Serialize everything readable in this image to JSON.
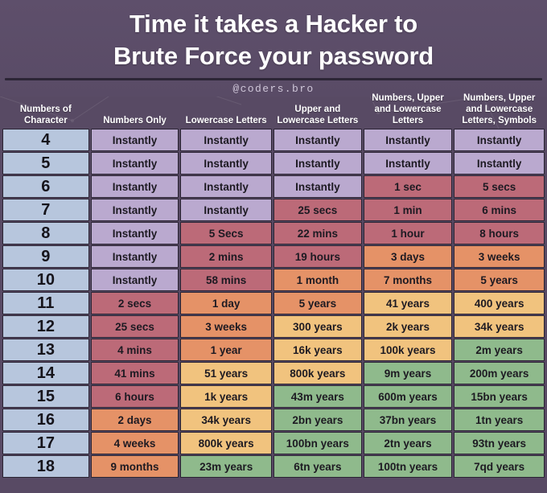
{
  "header": {
    "title_line_1": "Time it takes a Hacker to",
    "title_line_2": "Brute Force your password",
    "handle": "@coders.bro"
  },
  "colors": {
    "background": "#584a64",
    "rule": "#2c2536",
    "cell_border": "#2a2433",
    "blue": "#b7c6dd",
    "purple": "#baa9cf",
    "red": "#bc6a78",
    "orange": "#e59267",
    "yellow": "#f1c37e",
    "green": "#8fba8c"
  },
  "chart_data": {
    "type": "heatmap",
    "title": "Time it takes a Hacker to Brute Force your password",
    "subtitle": "@coders.bro",
    "xlabel": "",
    "ylabel": "Numbers of Character",
    "grid": true,
    "legend": "none",
    "columns": [
      "Numbers of Character",
      "Numbers Only",
      "Lowercase Letters",
      "Upper and Lowercase Letters",
      "Numbers, Upper and Lowercase Letters",
      "Numbers, Upper and Lowercase Letters, Symbols"
    ],
    "categories": [
      "4",
      "5",
      "6",
      "7",
      "8",
      "9",
      "10",
      "11",
      "12",
      "13",
      "14",
      "15",
      "16",
      "17",
      "18"
    ],
    "color_scale": [
      "purple",
      "red",
      "orange",
      "yellow",
      "green"
    ],
    "color_scale_meaning": "purple = instant, red = seconds to hours, orange = days to years, yellow = thousands of years, green = millions of years and beyond",
    "rows": [
      {
        "chars": "4",
        "cells": [
          {
            "text": "Instantly",
            "color": "purple"
          },
          {
            "text": "Instantly",
            "color": "purple"
          },
          {
            "text": "Instantly",
            "color": "purple"
          },
          {
            "text": "Instantly",
            "color": "purple"
          },
          {
            "text": "Instantly",
            "color": "purple"
          }
        ]
      },
      {
        "chars": "5",
        "cells": [
          {
            "text": "Instantly",
            "color": "purple"
          },
          {
            "text": "Instantly",
            "color": "purple"
          },
          {
            "text": "Instantly",
            "color": "purple"
          },
          {
            "text": "Instantly",
            "color": "purple"
          },
          {
            "text": "Instantly",
            "color": "purple"
          }
        ]
      },
      {
        "chars": "6",
        "cells": [
          {
            "text": "Instantly",
            "color": "purple"
          },
          {
            "text": "Instantly",
            "color": "purple"
          },
          {
            "text": "Instantly",
            "color": "purple"
          },
          {
            "text": "1 sec",
            "color": "red"
          },
          {
            "text": "5 secs",
            "color": "red"
          }
        ]
      },
      {
        "chars": "7",
        "cells": [
          {
            "text": "Instantly",
            "color": "purple"
          },
          {
            "text": "Instantly",
            "color": "purple"
          },
          {
            "text": "25 secs",
            "color": "red"
          },
          {
            "text": "1 min",
            "color": "red"
          },
          {
            "text": "6 mins",
            "color": "red"
          }
        ]
      },
      {
        "chars": "8",
        "cells": [
          {
            "text": "Instantly",
            "color": "purple"
          },
          {
            "text": "5 Secs",
            "color": "red"
          },
          {
            "text": "22 mins",
            "color": "red"
          },
          {
            "text": "1 hour",
            "color": "red"
          },
          {
            "text": "8 hours",
            "color": "red"
          }
        ]
      },
      {
        "chars": "9",
        "cells": [
          {
            "text": "Instantly",
            "color": "purple"
          },
          {
            "text": "2 mins",
            "color": "red"
          },
          {
            "text": "19 hours",
            "color": "red"
          },
          {
            "text": "3 days",
            "color": "orange"
          },
          {
            "text": "3 weeks",
            "color": "orange"
          }
        ]
      },
      {
        "chars": "10",
        "cells": [
          {
            "text": "Instantly",
            "color": "purple"
          },
          {
            "text": "58 mins",
            "color": "red"
          },
          {
            "text": "1 month",
            "color": "orange"
          },
          {
            "text": "7 months",
            "color": "orange"
          },
          {
            "text": "5 years",
            "color": "orange"
          }
        ]
      },
      {
        "chars": "11",
        "cells": [
          {
            "text": "2 secs",
            "color": "red"
          },
          {
            "text": "1 day",
            "color": "orange"
          },
          {
            "text": "5 years",
            "color": "orange"
          },
          {
            "text": "41 years",
            "color": "yellow"
          },
          {
            "text": "400 years",
            "color": "yellow"
          }
        ]
      },
      {
        "chars": "12",
        "cells": [
          {
            "text": "25 secs",
            "color": "red"
          },
          {
            "text": "3 weeks",
            "color": "orange"
          },
          {
            "text": "300 years",
            "color": "yellow"
          },
          {
            "text": "2k years",
            "color": "yellow"
          },
          {
            "text": "34k years",
            "color": "yellow"
          }
        ]
      },
      {
        "chars": "13",
        "cells": [
          {
            "text": "4 mins",
            "color": "red"
          },
          {
            "text": "1 year",
            "color": "orange"
          },
          {
            "text": "16k years",
            "color": "yellow"
          },
          {
            "text": "100k years",
            "color": "yellow"
          },
          {
            "text": "2m years",
            "color": "green"
          }
        ]
      },
      {
        "chars": "14",
        "cells": [
          {
            "text": "41 mins",
            "color": "red"
          },
          {
            "text": "51 years",
            "color": "yellow"
          },
          {
            "text": "800k years",
            "color": "yellow"
          },
          {
            "text": "9m years",
            "color": "green"
          },
          {
            "text": "200m years",
            "color": "green"
          }
        ]
      },
      {
        "chars": "15",
        "cells": [
          {
            "text": "6 hours",
            "color": "red"
          },
          {
            "text": "1k years",
            "color": "yellow"
          },
          {
            "text": "43m years",
            "color": "green"
          },
          {
            "text": "600m years",
            "color": "green"
          },
          {
            "text": "15bn years",
            "color": "green"
          }
        ]
      },
      {
        "chars": "16",
        "cells": [
          {
            "text": "2 days",
            "color": "orange"
          },
          {
            "text": "34k years",
            "color": "yellow"
          },
          {
            "text": "2bn years",
            "color": "green"
          },
          {
            "text": "37bn years",
            "color": "green"
          },
          {
            "text": "1tn years",
            "color": "green"
          }
        ]
      },
      {
        "chars": "17",
        "cells": [
          {
            "text": "4 weeks",
            "color": "orange"
          },
          {
            "text": "800k years",
            "color": "yellow"
          },
          {
            "text": "100bn years",
            "color": "green"
          },
          {
            "text": "2tn years",
            "color": "green"
          },
          {
            "text": "93tn years",
            "color": "green"
          }
        ]
      },
      {
        "chars": "18",
        "cells": [
          {
            "text": "9 months",
            "color": "orange"
          },
          {
            "text": "23m years",
            "color": "green"
          },
          {
            "text": "6tn years",
            "color": "green"
          },
          {
            "text": "100tn years",
            "color": "green"
          },
          {
            "text": "7qd years",
            "color": "green"
          }
        ]
      }
    ]
  }
}
